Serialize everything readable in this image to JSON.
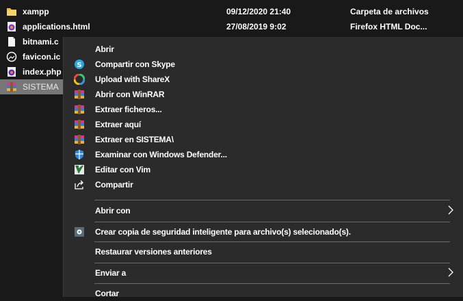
{
  "files": [
    {
      "name": "xampp",
      "date": "09/12/2020 21:40",
      "type": "Carpeta de archivos",
      "icon": "folder-icon"
    },
    {
      "name": "applications.html",
      "date": "27/08/2019 9:02",
      "type": "Firefox HTML Doc...",
      "icon": "firefox-document-icon"
    },
    {
      "name": "bitnami.c",
      "date": "",
      "type": "",
      "icon": "file-icon"
    },
    {
      "name": "favicon.ic",
      "date": "",
      "type": "",
      "icon": "image-icon"
    },
    {
      "name": "index.php",
      "date": "",
      "type": "",
      "icon": "php-file-icon"
    },
    {
      "name": "SISTEMA",
      "date": "",
      "type": "",
      "icon": "winrar-archive-icon"
    }
  ],
  "menu": {
    "abrir": "Abrir",
    "skype": "Compartir con Skype",
    "sharex": "Upload with ShareX",
    "winrar_open": "Abrir con WinRAR",
    "extract_files": "Extraer ficheros...",
    "extract_here": "Extraer aquí",
    "extract_to": "Extraer en SISTEMA\\",
    "defender": "Examinar con Windows Defender...",
    "vim": "Editar con Vim",
    "share": "Compartir",
    "open_with": "Abrir con",
    "backup": "Crear copia de seguridad inteligente para archivo(s) selecionado(s).",
    "restore": "Restaurar versiones anteriores",
    "send_to": "Enviar a",
    "cut_partial": "Cortar"
  },
  "colors": {
    "background": "#191919",
    "menu_background": "#2b2b2b",
    "selection": "#777777",
    "separator": "#6a6a6a"
  }
}
